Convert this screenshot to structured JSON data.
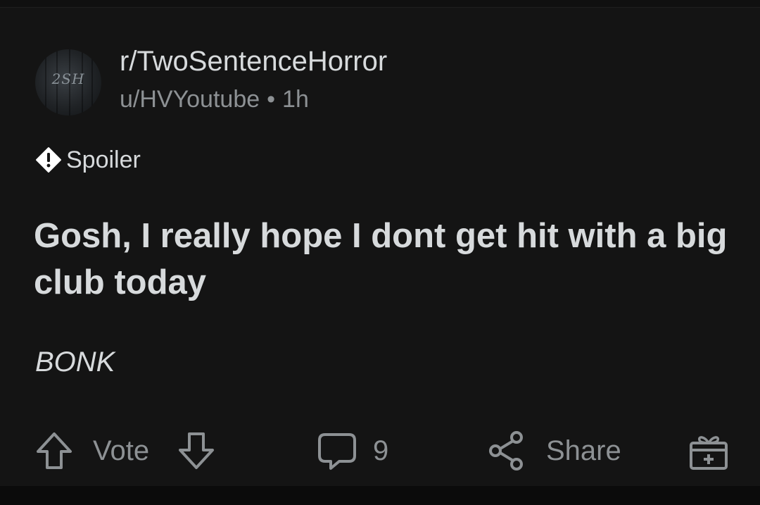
{
  "post": {
    "subreddit": "r/TwoSentenceHorror",
    "author": "u/HVYoutube",
    "separator": "•",
    "age": "1h",
    "avatar_text": "2SH",
    "spoiler_label": "Spoiler",
    "title": "Gosh, I really hope I dont get hit with a big club today",
    "body": "BONK"
  },
  "actions": {
    "vote_label": "Vote",
    "comment_count": "9",
    "share_label": "Share"
  },
  "icons": {
    "spoiler": "alert-icon",
    "upvote": "arrow-up-icon",
    "downvote": "arrow-down-icon",
    "comments": "speech-bubble-icon",
    "share": "share-icon",
    "award": "gift-icon"
  },
  "colors": {
    "background": "#141414",
    "primary_text": "#d7dadc",
    "secondary_text": "#8d9194"
  }
}
